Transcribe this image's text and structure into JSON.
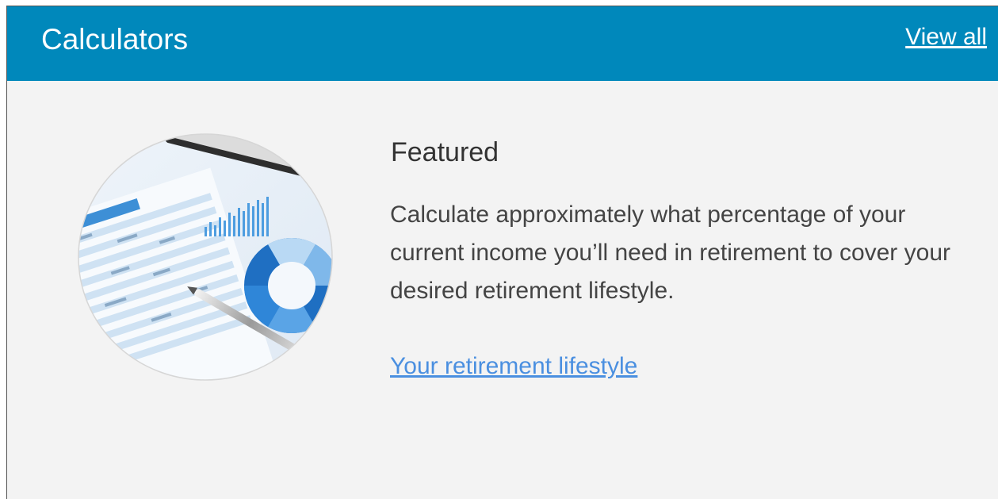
{
  "header": {
    "title": "Calculators",
    "view_all_label": "View all"
  },
  "featured": {
    "heading": "Featured",
    "description": "Calculate approximately what percentage of your current income you’ll need in retirement to cover your desired retirement lifestyle.",
    "link_label": "Your retirement lifestyle",
    "image": "calculator-financial-charts-photo"
  },
  "colors": {
    "header_bg": "#0088bb",
    "panel_bg": "#f3f3f3",
    "link": "#4a8fe0"
  }
}
